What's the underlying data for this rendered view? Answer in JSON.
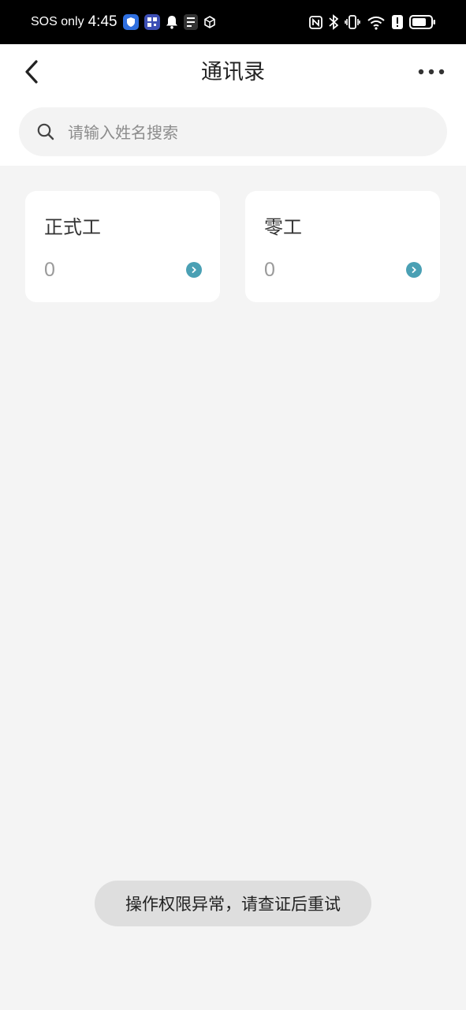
{
  "status_bar": {
    "carrier": "SOS only",
    "time": "4:45",
    "icons_left": [
      "shield-app-icon",
      "qr-app-icon",
      "bell-icon",
      "sim-app-icon",
      "cube-app-icon"
    ],
    "icons_right": [
      "nfc-icon",
      "bluetooth-icon",
      "vibrate-icon",
      "wifi-icon",
      "alert-icon",
      "battery-icon"
    ]
  },
  "header": {
    "title": "通讯录",
    "back_icon": "chevron-left-icon",
    "more_icon": "more-horizontal-icon"
  },
  "search": {
    "placeholder": "请输入姓名搜索",
    "value": ""
  },
  "cards": [
    {
      "title": "正式工",
      "count": "0"
    },
    {
      "title": "零工",
      "count": "0"
    }
  ],
  "colors": {
    "accent": "#4aa0b4",
    "page_bg": "#f4f4f4",
    "card_bg": "#ffffff"
  },
  "toast": {
    "message": "操作权限异常，请查证后重试"
  }
}
